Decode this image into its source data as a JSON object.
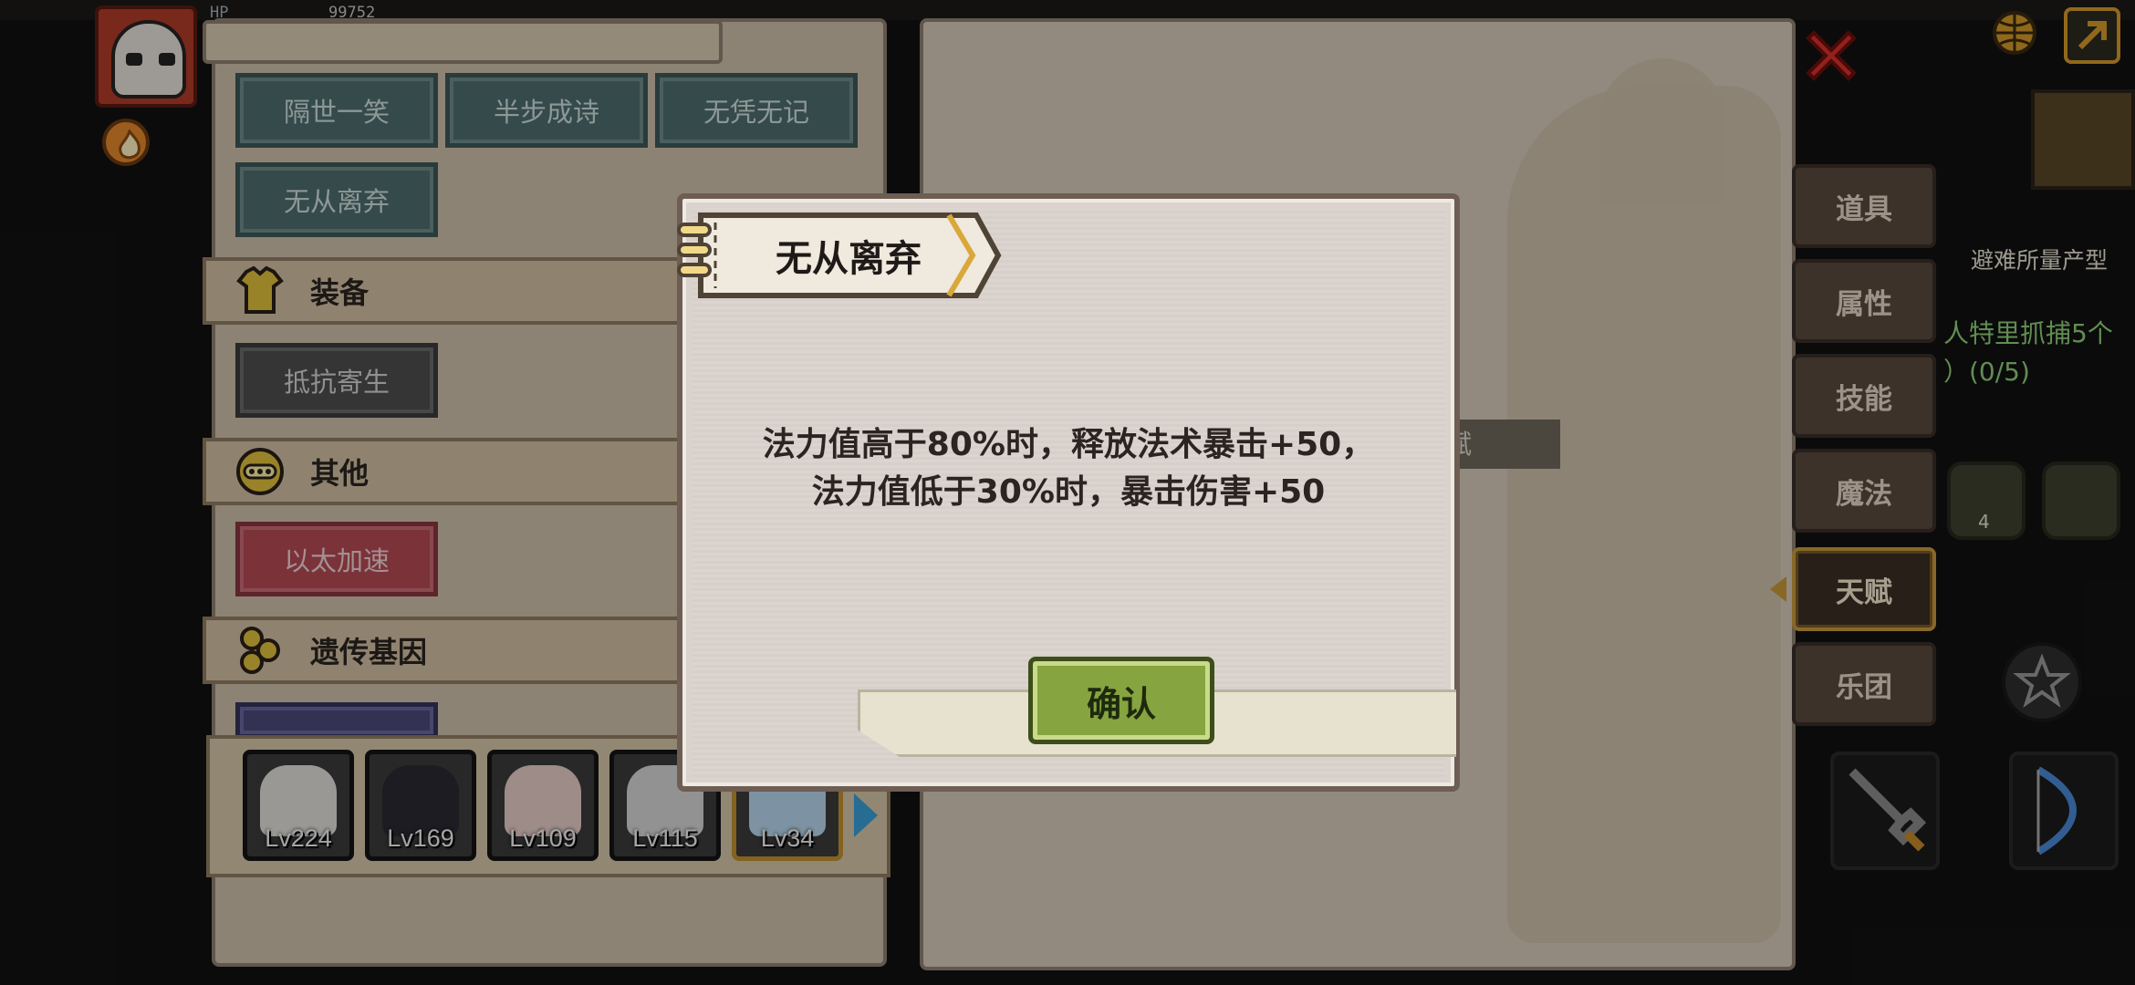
{
  "hud": {
    "hp_label": "HP",
    "hp_value": "99752"
  },
  "left_panel": {
    "chips_top": [
      "隔世一笑",
      "半步成诗",
      "无凭无记",
      "无从离弃"
    ],
    "sections": [
      {
        "label": "装备",
        "icon": "armor-icon"
      },
      {
        "label": "其他",
        "icon": "ring-icon"
      },
      {
        "label": "遗传基因",
        "icon": "gene-icon"
      }
    ],
    "chip_equipment": "抵抗寄生",
    "chip_other": "以太加速"
  },
  "characters": [
    {
      "level": "Lv224",
      "color": "#e4e0dc"
    },
    {
      "level": "Lv169",
      "color": "#2a2a33"
    },
    {
      "level": "Lv109",
      "color": "#e8cfc8"
    },
    {
      "level": "Lv115",
      "color": "#d8d8d8"
    },
    {
      "level": "Lv34",
      "color": "#b9d8ef",
      "selected": true
    }
  ],
  "right_tabs": [
    "道具",
    "属性",
    "技能",
    "魔法",
    "天赋",
    "乐团"
  ],
  "right_tabs_active": "天赋",
  "right_panel": {
    "talent_strip": "赋"
  },
  "side_info": {
    "line1": "避难所量产型",
    "line2": "人特里抓捕5个",
    "line3": "）(0/5)",
    "count": "4"
  },
  "dialog": {
    "title": "无从离弃",
    "desc_line1": "法力值高于80%时，释放法术暴击+50，",
    "desc_line2": "法力值低于30%时，暴击伤害+50",
    "confirm_label": "确认"
  },
  "colors": {
    "accent_gold": "#c79a3a",
    "confirm_green": "#86a43f",
    "chip_teal": "#4f6e6e"
  }
}
